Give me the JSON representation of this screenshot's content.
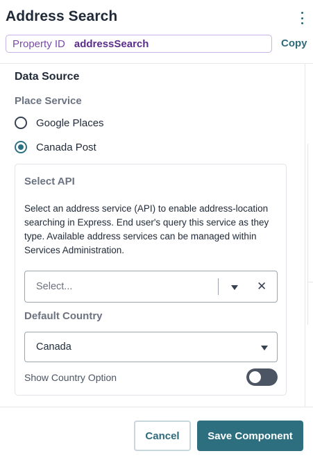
{
  "header": {
    "title": "Address Search",
    "menu_icon": "kebab-vertical-icon",
    "property_id_label": "Property ID",
    "property_id_value": "addressSearch",
    "copy_label": "Copy"
  },
  "data_source": {
    "title": "Data Source",
    "place_service_label": "Place Service",
    "options": [
      {
        "label": "Google Places",
        "checked": false
      },
      {
        "label": "Canada Post",
        "checked": true
      }
    ]
  },
  "select_api": {
    "title": "Select API",
    "description": "Select an address service (API) to enable address-location searching in Express. End user's query this service as they type. Available address services can be managed within Services Administration.",
    "placeholder": "Select...",
    "caret_icon": "caret-down-icon",
    "clear_icon": "close-icon",
    "clear_glyph": "✕"
  },
  "default_country": {
    "label": "Default Country",
    "value": "Canada"
  },
  "show_country_option": {
    "label": "Show Country Option",
    "enabled": false
  },
  "footer": {
    "cancel_label": "Cancel",
    "save_label": "Save Component"
  },
  "colors": {
    "accent": "#2d6e7f",
    "property_border": "#c9b3e6",
    "property_text": "#5b2d8a"
  }
}
